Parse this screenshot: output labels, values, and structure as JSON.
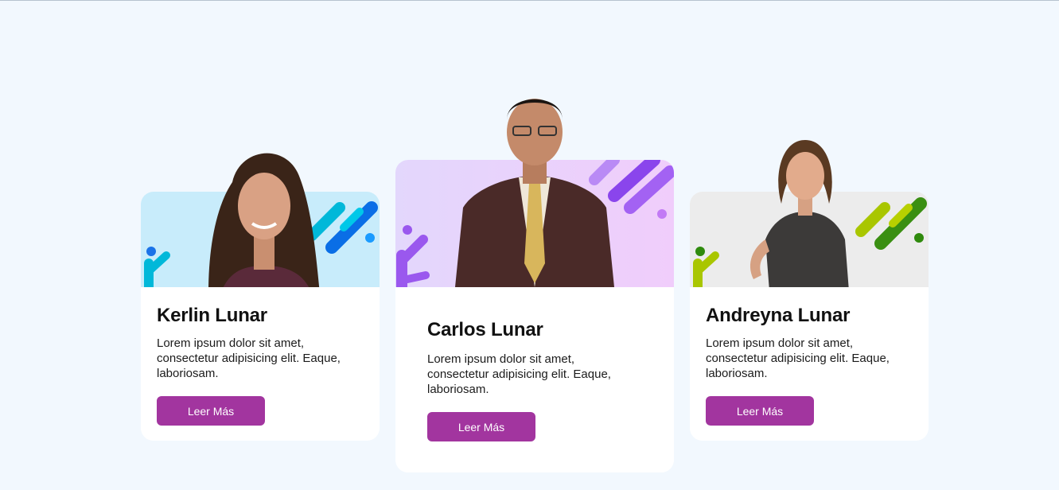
{
  "team": {
    "members": [
      {
        "name": "Kerlin Lunar",
        "description": "Lorem ipsum dolor sit amet, consectetur adipisicing elit. Eaque, laboriosam.",
        "button_label": "Leer Más",
        "theme": {
          "bg": "#c8ecfb",
          "accent1": "#00b4d8",
          "accent2": "#0066e0"
        }
      },
      {
        "name": "Carlos Lunar",
        "description": "Lorem ipsum dolor sit amet, consectetur adipisicing elit. Eaque, laboriosam.",
        "button_label": "Leer Más",
        "theme": {
          "bg": "#e6d3fb",
          "accent1": "#9b5cf0",
          "accent2": "#6c2fe0"
        }
      },
      {
        "name": "Andreyna Lunar",
        "description": "Lorem ipsum dolor sit amet, consectetur adipisicing elit. Eaque, laboriosam.",
        "button_label": "Leer Más",
        "theme": {
          "bg": "#ececec",
          "accent1": "#a5c400",
          "accent2": "#2f8a0d"
        }
      }
    ]
  },
  "colors": {
    "page_bg": "#f2f8fe",
    "button_bg": "#a2359f",
    "button_text": "#ffffff"
  }
}
